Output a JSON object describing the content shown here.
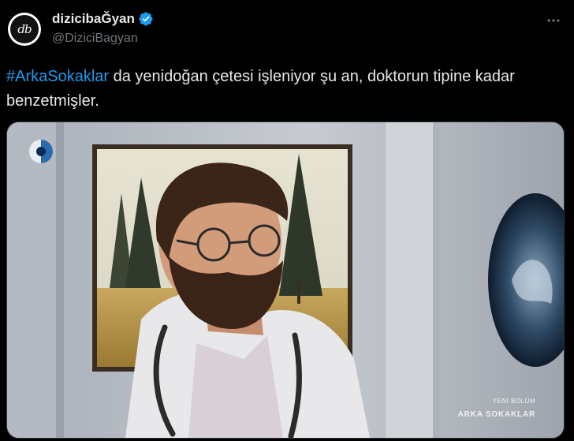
{
  "author": {
    "display_name": "dizicibaĞyan",
    "handle": "@DiziciBagyan",
    "avatar_text": "db",
    "verified": true
  },
  "tweet": {
    "hashtag": "#ArkaSokaklar",
    "text_rest": " da yenidoğan çetesi işleniyor şu an, doktorun tipine kadar benzetmişler."
  },
  "media": {
    "caption_top": "YENİ BÖLÜM",
    "caption_bottom": "ARKA SOKAKLAR"
  },
  "icons": {
    "more": "more-icon",
    "verified": "verified-badge-icon",
    "channel": "kanal-d-logo-icon"
  },
  "colors": {
    "background": "#000000",
    "text": "#e7e9ea",
    "secondary_text": "#71767b",
    "hashtag": "#1d9bf0",
    "verified": "#1d9bf0"
  }
}
